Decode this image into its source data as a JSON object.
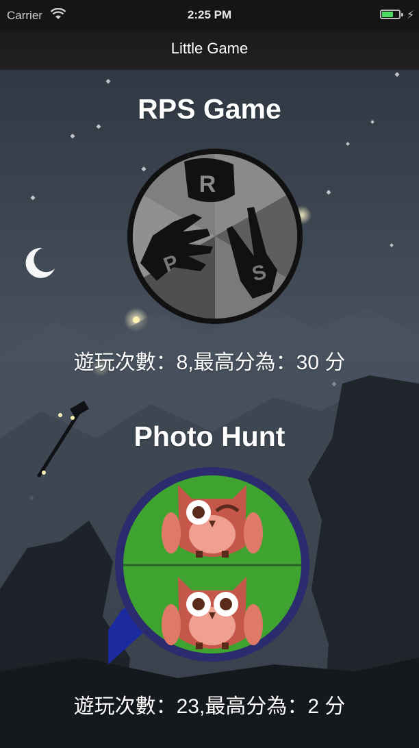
{
  "status_bar": {
    "carrier": "Carrier",
    "time": "2:25 PM",
    "battery_color": "#4cd964"
  },
  "nav": {
    "title": "Little Game"
  },
  "games": [
    {
      "title": "RPS  Game",
      "icon": "rock-paper-scissors-icon",
      "stats": "遊玩次數：8,最高分為：30 分"
    },
    {
      "title": "Photo Hunt",
      "icon": "owl-photo-hunt-icon",
      "stats": "遊玩次數：23,最高分為：2 分"
    }
  ],
  "colors": {
    "background": "#2b3440",
    "accent_green": "#3fa32f",
    "owl_red": "#c4564a"
  }
}
